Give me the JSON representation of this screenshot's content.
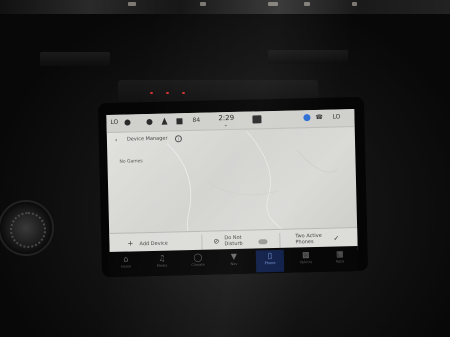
{
  "status_bar": {
    "left_label": "LO",
    "clock": "2:29",
    "right_label": "LO",
    "temp_small": "84"
  },
  "page": {
    "back_glyph": "‹",
    "title": "Device Manager",
    "info_glyph": "i",
    "empty_text": "No Games"
  },
  "actions": {
    "add_device_label": "Add Device",
    "do_not_disturb_label": "Do Not Disturb",
    "two_active_phones_label": "Two Active Phones"
  },
  "dock": {
    "items": [
      {
        "label": "Home",
        "icon": "home-icon"
      },
      {
        "label": "Media",
        "icon": "music-note-icon"
      },
      {
        "label": "Climate",
        "icon": "climate-icon"
      },
      {
        "label": "Nav",
        "icon": "navigation-icon"
      },
      {
        "label": "Phone",
        "icon": "phone-icon",
        "active": true
      },
      {
        "label": "Vehicle",
        "icon": "vehicle-icon"
      },
      {
        "label": "Apps",
        "icon": "apps-grid-icon"
      }
    ]
  },
  "colors": {
    "accent_blue": "#2f6fd6",
    "active_dock": "#10204a"
  }
}
